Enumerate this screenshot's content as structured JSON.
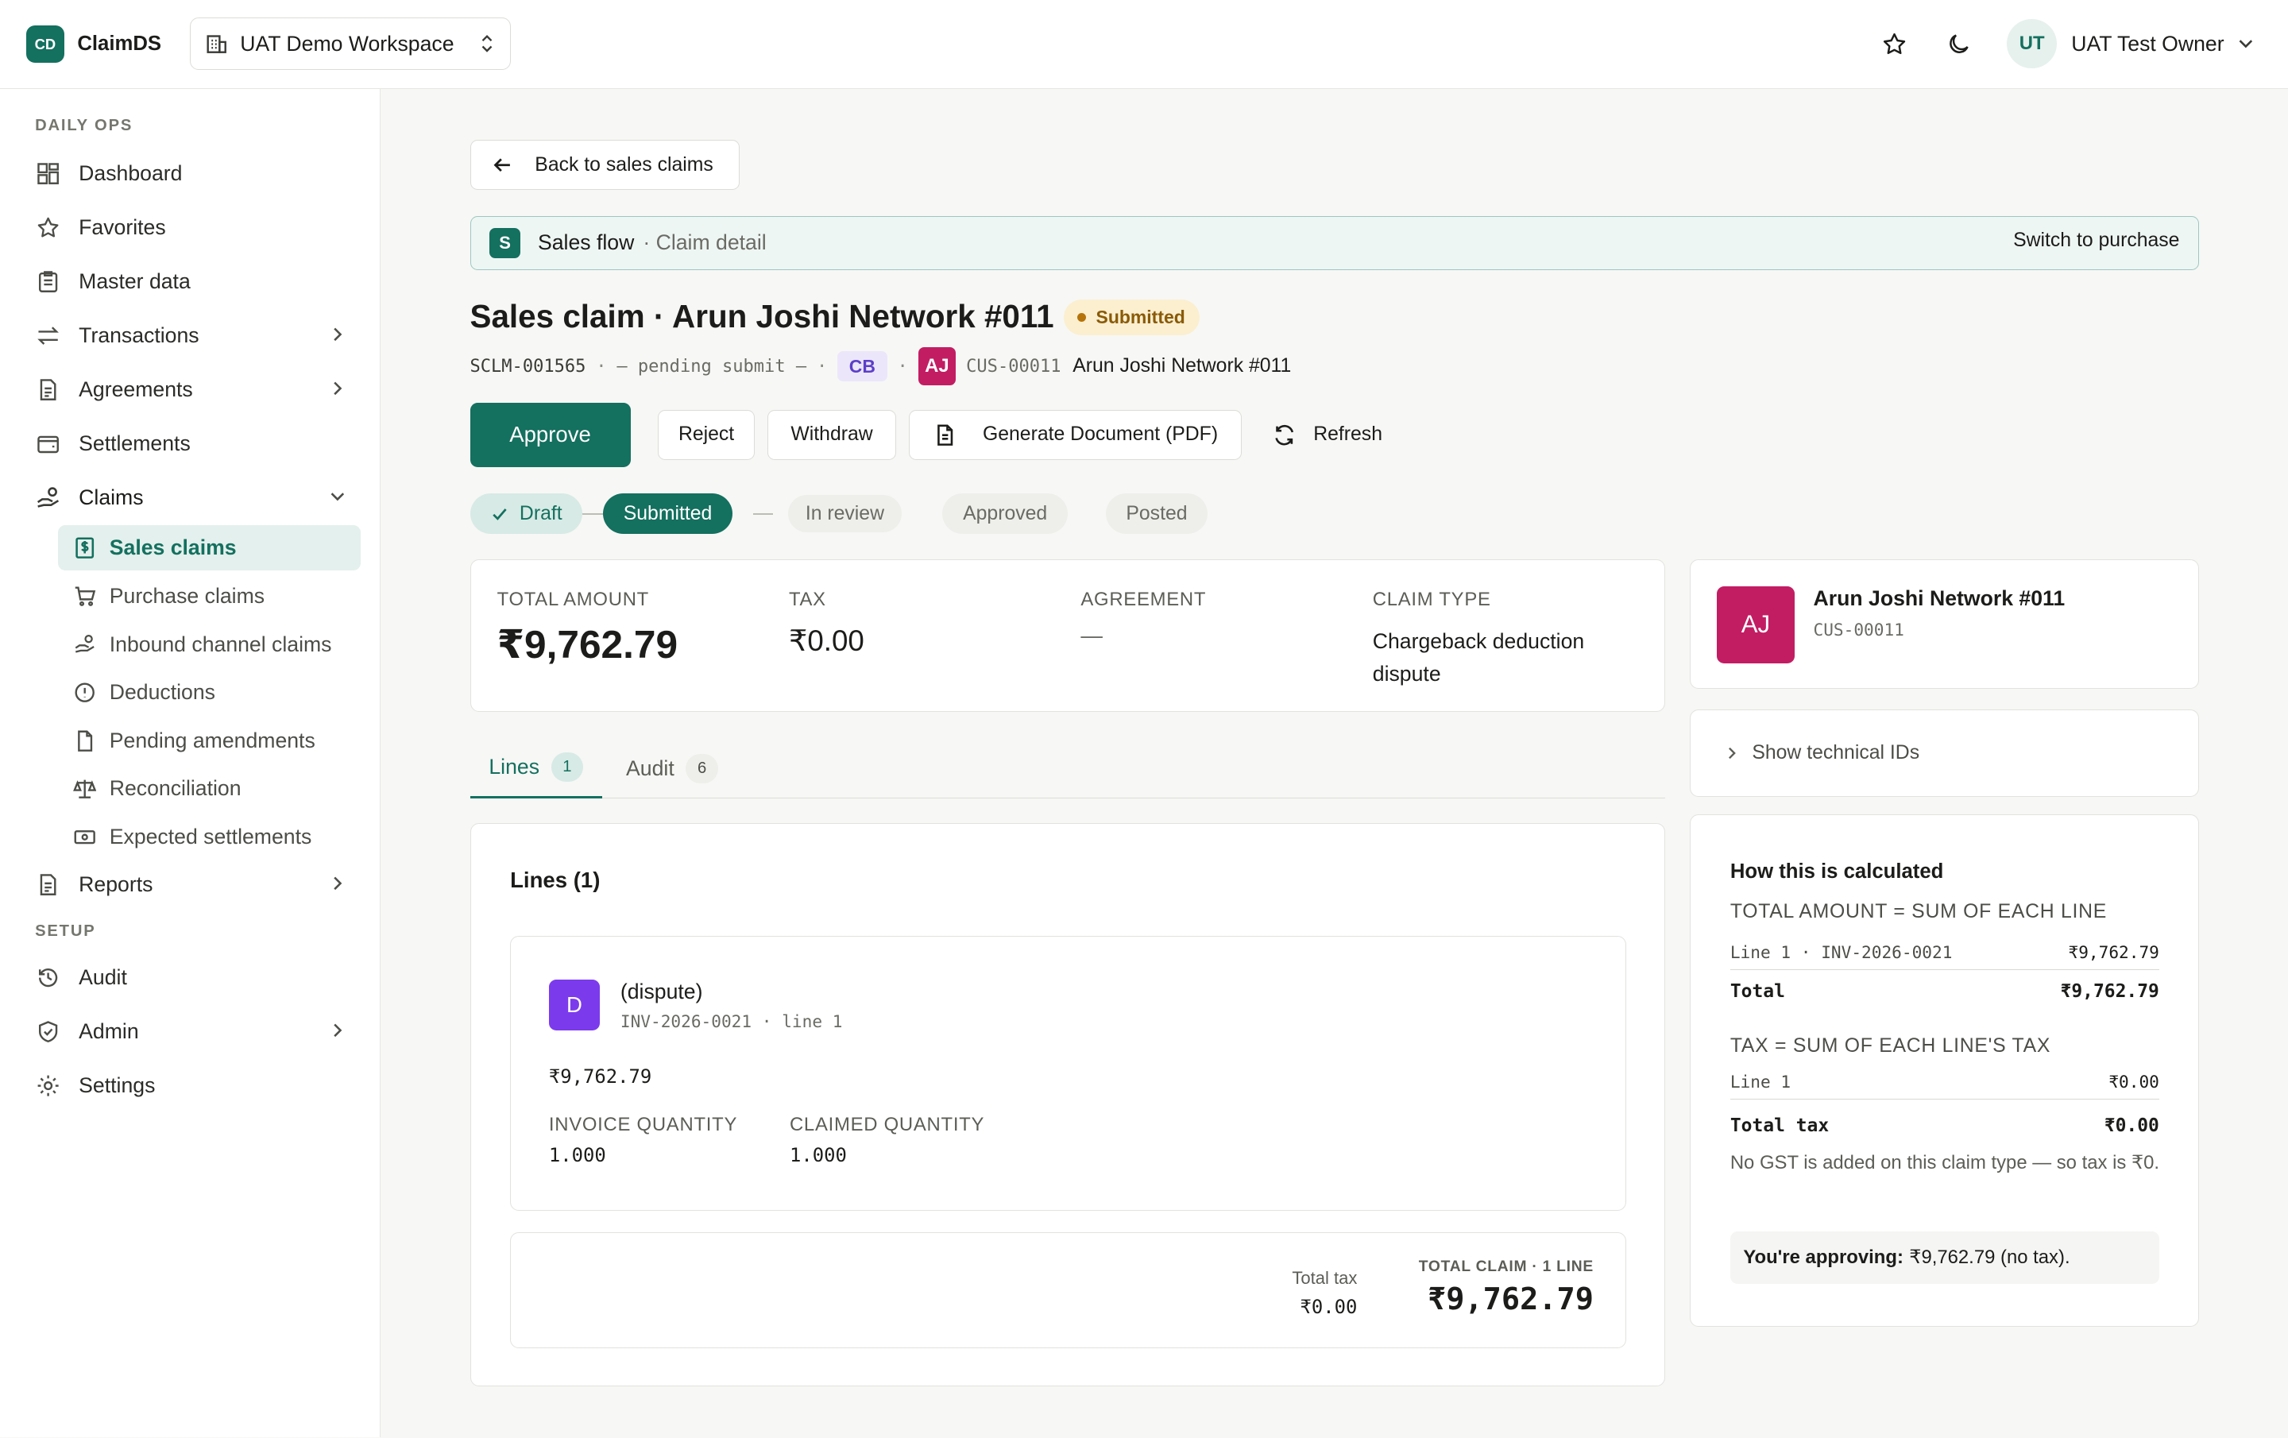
{
  "app": {
    "logo_text": "CD",
    "name": "ClaimDS",
    "workspace": "UAT Demo Workspace",
    "user_initials": "UT",
    "user_name": "UAT Test Owner"
  },
  "sidebar": {
    "daily_ops_label": "DAILY OPS",
    "setup_label": "SETUP",
    "items": {
      "dashboard": "Dashboard",
      "favorites": "Favorites",
      "master_data": "Master data",
      "transactions": "Transactions",
      "agreements": "Agreements",
      "settlements": "Settlements",
      "claims": "Claims",
      "reports": "Reports",
      "audit": "Audit",
      "admin": "Admin",
      "settings": "Settings"
    },
    "claims_sub": {
      "sales_claims": "Sales claims",
      "purchase_claims": "Purchase claims",
      "inbound_channel_claims": "Inbound channel claims",
      "deductions": "Deductions",
      "pending_amendments": "Pending amendments",
      "reconciliation": "Reconciliation",
      "expected_settlements": "Expected settlements"
    }
  },
  "main": {
    "back_label": "Back to sales claims",
    "flow": {
      "badge": "S",
      "title": "Sales flow",
      "subtitle": "· Claim detail",
      "switch_label": "Switch to purchase"
    },
    "title": "Sales claim · Arun Joshi Network #011",
    "status": "Submitted",
    "meta": {
      "claim_id": "SCLM-001565",
      "dot1": "·",
      "pending": "— pending submit —",
      "dot2": "·",
      "cb_tag": "CB",
      "dot3": "·",
      "customer_initials": "AJ",
      "customer_code": "CUS-00011",
      "customer_name": "Arun Joshi Network #011"
    },
    "actions": {
      "approve": "Approve",
      "reject": "Reject",
      "withdraw": "Withdraw",
      "generate": "Generate Document (PDF)",
      "refresh": "Refresh"
    },
    "steps": {
      "draft": "Draft",
      "submitted": "Submitted",
      "in_review": "In review",
      "approved": "Approved",
      "posted": "Posted"
    },
    "summary": {
      "total_amount_label": "TOTAL AMOUNT",
      "total_amount": "₹9,762.79",
      "tax_label": "TAX",
      "tax": "₹0.00",
      "agreement_label": "AGREEMENT",
      "agreement": "—",
      "claim_type_label": "CLAIM TYPE",
      "claim_type_line1": "Chargeback deduction",
      "claim_type_line2": "dispute"
    },
    "tabs": {
      "lines_label": "Lines",
      "lines_count": "1",
      "audit_label": "Audit",
      "audit_count": "6"
    },
    "lines_panel": {
      "heading": "Lines (1)",
      "line": {
        "badge": "D",
        "title": "(dispute)",
        "ref": "INV-2026-0021 · line 1",
        "amount": "₹9,762.79",
        "invoice_qty_label": "INVOICE QUANTITY",
        "invoice_qty": "1.000",
        "claimed_qty_label": "CLAIMED QUANTITY",
        "claimed_qty": "1.000"
      },
      "footer": {
        "total_tax_label": "Total tax",
        "total_tax": "₹0.00",
        "total_claim_label": "TOTAL CLAIM · 1 LINE",
        "total_claim": "₹9,762.79"
      }
    }
  },
  "right_panel": {
    "customer": {
      "initials": "AJ",
      "name": "Arun Joshi Network #011",
      "code": "CUS-00011"
    },
    "technical_ids_label": "Show technical IDs",
    "calc": {
      "heading": "How this is calculated",
      "total_formula": "TOTAL AMOUNT = SUM OF EACH LINE",
      "total_line_label": "Line 1 · INV-2026-0021",
      "total_line_value": "₹9,762.79",
      "total_label": "Total",
      "total_value": "₹9,762.79",
      "tax_formula": "TAX = SUM OF EACH LINE'S TAX",
      "tax_line_label": "Line 1",
      "tax_line_value": "₹0.00",
      "total_tax_label": "Total tax",
      "total_tax_value": "₹0.00",
      "note": "No GST is added on this claim type — so tax is ₹0.",
      "approving_prefix": "You're approving:",
      "approving_value": "₹9,762.79 (no tax)."
    }
  },
  "colors": {
    "brand": "#14705f",
    "status_submitted_bg": "#fbefd0",
    "customer_avatar": "#c21d63",
    "line_badge": "#7c3aed"
  }
}
